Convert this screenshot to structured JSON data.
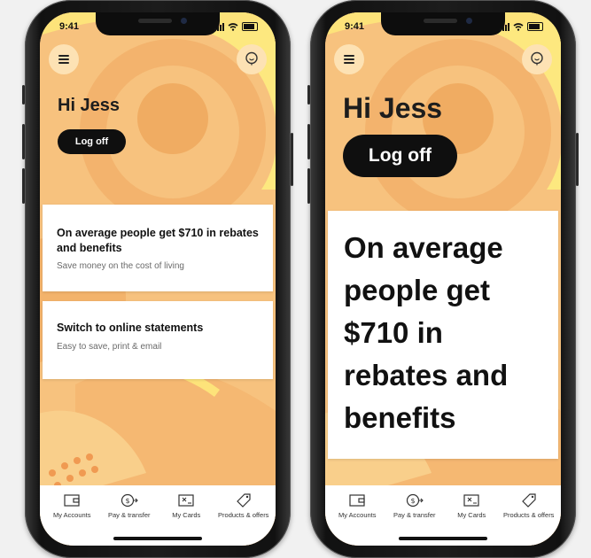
{
  "status": {
    "time": "9:41"
  },
  "left": {
    "greeting": "Hi Jess",
    "logoff": "Log off",
    "cards": [
      {
        "title": "On average people get $710 in rebates and benefits",
        "subtitle": "Save money on the cost of living"
      },
      {
        "title": "Switch to online statements",
        "subtitle": "Easy to save, print & email"
      }
    ]
  },
  "right": {
    "greeting": "Hi Jess",
    "logoff": "Log off",
    "card_title": "On average people get $710 in rebates and benefits"
  },
  "tabs": [
    {
      "label": "My Accounts",
      "icon": "wallet-icon"
    },
    {
      "label": "Pay & transfer",
      "icon": "pay-transfer-icon"
    },
    {
      "label": "My Cards",
      "icon": "card-icon"
    },
    {
      "label": "Products & offers",
      "icon": "tag-icon"
    }
  ],
  "colors": {
    "background": "#f7c27e",
    "button": "#0f0f0f",
    "card": "#ffffff"
  }
}
